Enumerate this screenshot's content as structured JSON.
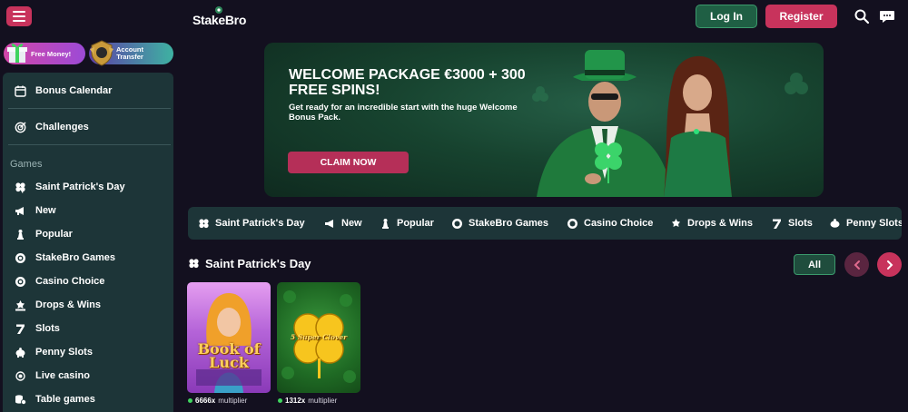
{
  "header": {
    "logo_text": "StakeBro",
    "login_label": "Log In",
    "register_label": "Register",
    "search_icon": "search-icon",
    "chat_icon": "chat-icon"
  },
  "promos": {
    "free_money": "Free Money!",
    "account_transfer_line1": "Account",
    "account_transfer_line2": "Transfer"
  },
  "sidebar": {
    "top_items": [
      {
        "label": "Bonus Calendar",
        "icon": "calendar-icon"
      },
      {
        "label": "Challenges",
        "icon": "target-icon"
      }
    ],
    "games_heading": "Games",
    "items": [
      {
        "label": "Saint Patrick's Day",
        "icon": "clover-icon"
      },
      {
        "label": "New",
        "icon": "megaphone-icon"
      },
      {
        "label": "Popular",
        "icon": "chess-pawn-icon"
      },
      {
        "label": "StakeBro Games",
        "icon": "chip-icon"
      },
      {
        "label": "Casino Choice",
        "icon": "chip-icon"
      },
      {
        "label": "Drops & Wins",
        "icon": "drops-wins-icon"
      },
      {
        "label": "Slots",
        "icon": "seven-icon"
      },
      {
        "label": "Penny Slots",
        "icon": "piggy-bank-icon"
      },
      {
        "label": "Live casino",
        "icon": "live-icon"
      },
      {
        "label": "Table games",
        "icon": "coins-icon"
      }
    ]
  },
  "banner": {
    "title": "WELCOME PACKAGE €3000 + 300 FREE SPINS!",
    "subtitle": "Get ready for an incredible start with the huge Welcome Bonus Pack.",
    "cta_label": "CLAIM NOW"
  },
  "categories": [
    {
      "label": "Saint Patrick's Day",
      "icon": "clover-icon"
    },
    {
      "label": "New",
      "icon": "megaphone-icon"
    },
    {
      "label": "Popular",
      "icon": "chess-pawn-icon"
    },
    {
      "label": "StakeBro Games",
      "icon": "chip-icon"
    },
    {
      "label": "Casino Choice",
      "icon": "chip-icon"
    },
    {
      "label": "Drops & Wins",
      "icon": "drops-wins-icon"
    },
    {
      "label": "Slots",
      "icon": "seven-icon"
    },
    {
      "label": "Penny Slots",
      "icon": "piggy-bank-icon"
    }
  ],
  "section": {
    "title": "Saint Patrick's Day",
    "all_label": "All"
  },
  "games": [
    {
      "title": "Book of Luck",
      "multiplier": "6666x",
      "multiplier_label": "multiplier"
    },
    {
      "title": "5 Super Clover",
      "multiplier": "1312x",
      "multiplier_label": "multiplier"
    }
  ],
  "colors": {
    "background": "#13101f",
    "panel": "#1d3538",
    "accent_pink": "#c8335c",
    "accent_green": "#1f5f44"
  }
}
